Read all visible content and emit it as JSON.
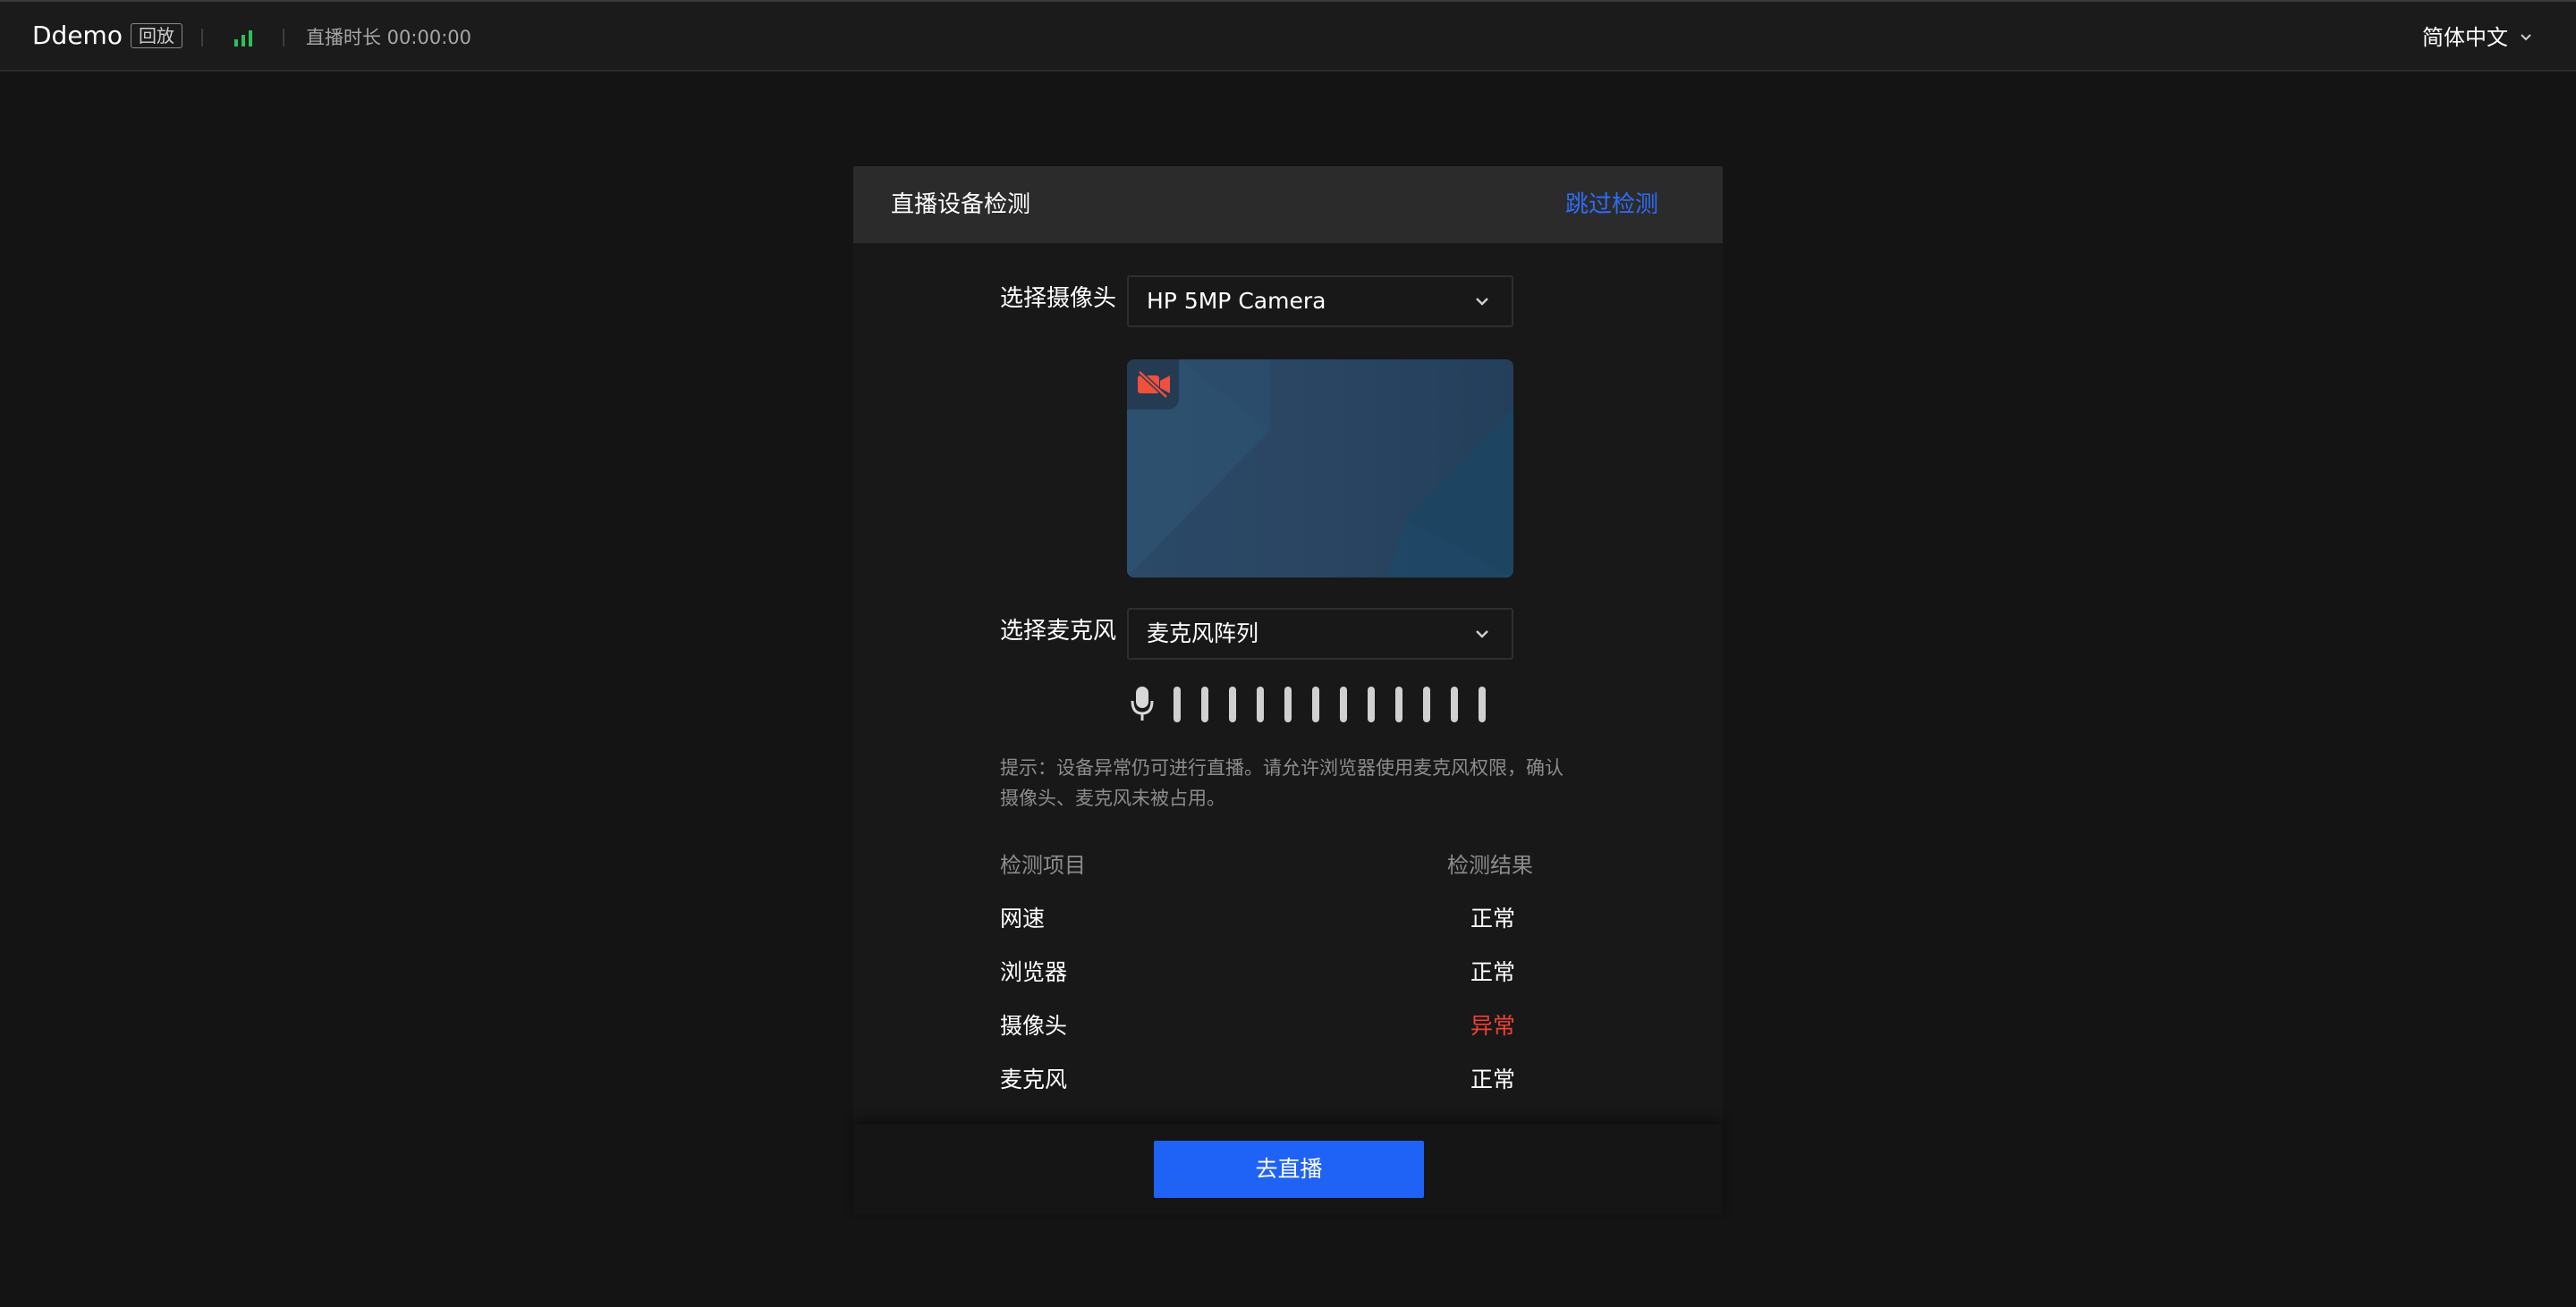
{
  "header": {
    "app_title": "Ddemo",
    "replay_badge": "回放",
    "duration_label": "直播时长 00:00:00",
    "signal_icon": "signal-bars-icon",
    "signal_color": "#2fbf5a",
    "language": "简体中文"
  },
  "panel": {
    "title": "直播设备检测",
    "skip_label": "跳过检测",
    "camera": {
      "label": "选择摄像头",
      "selected": "HP 5MP Camera",
      "status_icon": "camera-off-icon"
    },
    "microphone": {
      "label": "选择麦克风",
      "selected": "麦克风阵列",
      "icon": "microphone-icon",
      "level_bars": 12,
      "level": 0
    },
    "hint": "提示：设备异常仍可进行直播。请允许浏览器使用麦克风权限，确认摄像头、麦克风未被占用。",
    "table": {
      "col_item": "检测项目",
      "col_result": "检测结果",
      "rows": [
        {
          "item": "网速",
          "result": "正常"
        },
        {
          "item": "浏览器",
          "result": "正常"
        },
        {
          "item": "摄像头",
          "result": "异常"
        },
        {
          "item": "麦克风",
          "result": "正常"
        }
      ]
    },
    "go_live_label": "去直播"
  },
  "colors": {
    "accent": "#1e63f6",
    "link": "#2f6cf5",
    "error": "#f04136",
    "background": "#141414"
  }
}
